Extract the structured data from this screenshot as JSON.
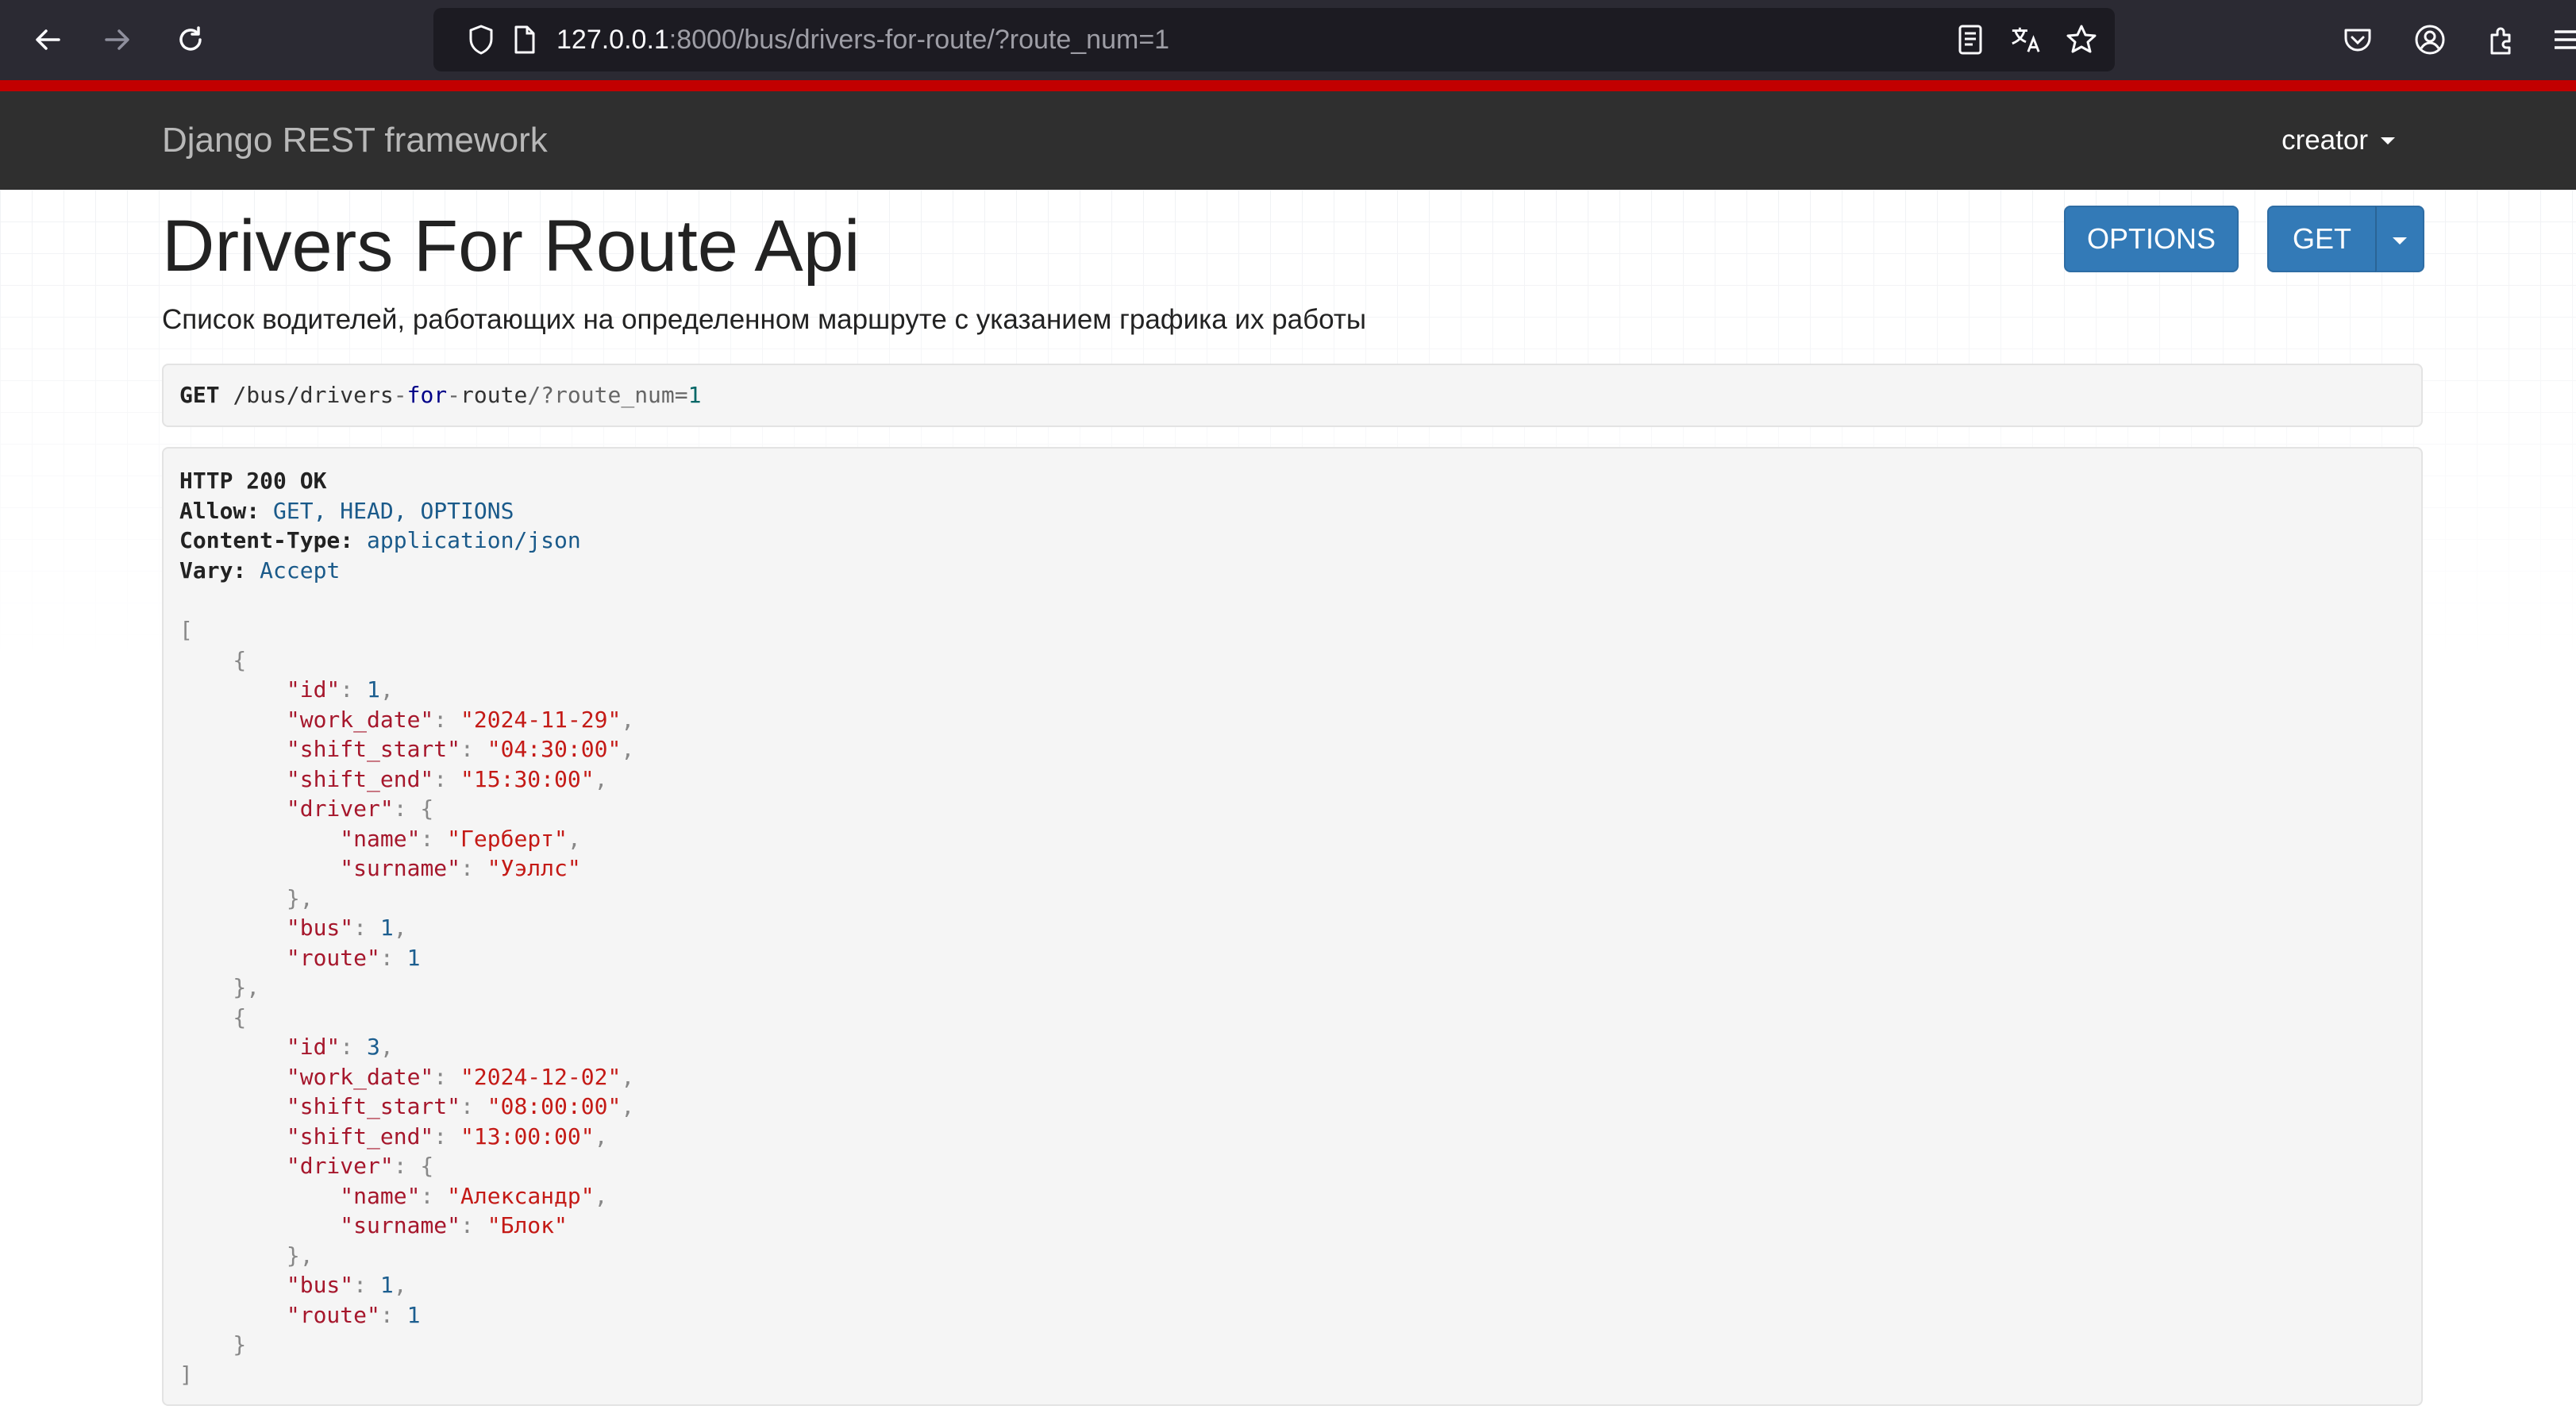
{
  "browser": {
    "url_host": "127.0.0.1",
    "url_rest": ":8000/bus/drivers-for-route/?route_num=1",
    "icons": [
      "back-arrow-icon",
      "forward-arrow-icon",
      "reload-icon",
      "shield-icon",
      "page-icon",
      "reader-view-icon",
      "translate-icon",
      "star-icon",
      "pocket-icon",
      "account-icon",
      "extensions-icon",
      "menu-icon"
    ]
  },
  "navbar": {
    "brand": "Django REST framework",
    "user": "creator"
  },
  "page": {
    "title": "Drivers For Route Api",
    "description": "Список водителей, работающих на определенном маршруте с указанием графика их работы",
    "buttons": {
      "options": "OPTIONS",
      "get": "GET"
    }
  },
  "request": {
    "method": "GET",
    "path_1": "/bus/drivers",
    "path_2": "for",
    "path_3": "route",
    "path_4": "/?route_num",
    "value": "1"
  },
  "response": {
    "status": "HTTP 200 OK",
    "headers": [
      {
        "name": "Allow:",
        "value": "GET, HEAD, OPTIONS"
      },
      {
        "name": "Content-Type:",
        "value": "application/json"
      },
      {
        "name": "Vary:",
        "value": "Accept"
      }
    ],
    "items": [
      {
        "id": "1",
        "work_date": "\"2024-11-29\"",
        "shift_start": "\"04:30:00\"",
        "shift_end": "\"15:30:00\"",
        "driver_name": "\"Герберт\"",
        "driver_surname": "\"Уэллс\"",
        "bus": "1",
        "route": "1"
      },
      {
        "id": "3",
        "work_date": "\"2024-12-02\"",
        "shift_start": "\"08:00:00\"",
        "shift_end": "\"13:00:00\"",
        "driver_name": "\"Александр\"",
        "driver_surname": "\"Блок\"",
        "bus": "1",
        "route": "1"
      }
    ]
  }
}
